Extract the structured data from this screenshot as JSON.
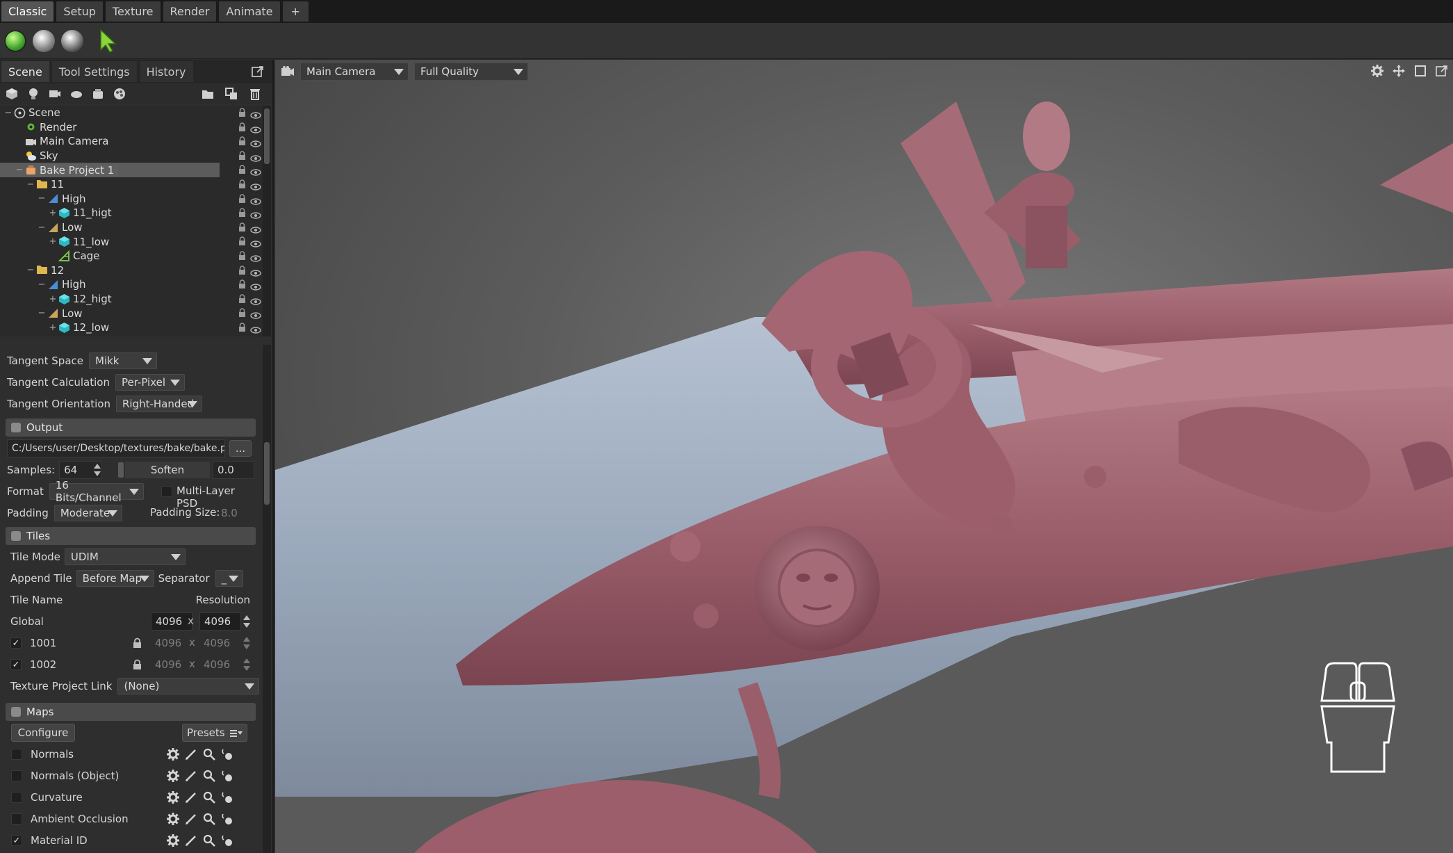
{
  "menu_tabs": [
    "Classic",
    "Setup",
    "Texture",
    "Render",
    "Animate",
    "+"
  ],
  "toolbar": {
    "icons": [
      "render-sphere-green-icon",
      "sphere-grey-icon",
      "sphere-shaded-icon",
      "select-arrow-icon"
    ]
  },
  "panel_tabs": [
    "Scene",
    "Tool Settings",
    "History"
  ],
  "scene_tree": [
    {
      "label": "Scene",
      "depth": 0,
      "icon": "scene-icon",
      "expander": "−"
    },
    {
      "label": "Render",
      "depth": 1,
      "icon": "gear-icon",
      "expander": ""
    },
    {
      "label": "Main Camera",
      "depth": 1,
      "icon": "camera-icon",
      "expander": ""
    },
    {
      "label": "Sky",
      "depth": 1,
      "icon": "sky-icon",
      "expander": ""
    },
    {
      "label": "Bake Project 1",
      "depth": 1,
      "icon": "bake-icon",
      "expander": "−",
      "selected": true
    },
    {
      "label": "11",
      "depth": 2,
      "icon": "folder-icon",
      "expander": "−"
    },
    {
      "label": "High",
      "depth": 3,
      "icon": "high-group-icon",
      "expander": "−"
    },
    {
      "label": "11_higt",
      "depth": 4,
      "icon": "mesh-icon",
      "expander": "+"
    },
    {
      "label": "Low",
      "depth": 3,
      "icon": "low-group-icon",
      "expander": "−"
    },
    {
      "label": "11_low",
      "depth": 4,
      "icon": "mesh-icon",
      "expander": "+"
    },
    {
      "label": "Cage",
      "depth": 4,
      "icon": "cage-icon",
      "expander": ""
    },
    {
      "label": "12",
      "depth": 2,
      "icon": "folder-icon",
      "expander": "−"
    },
    {
      "label": "High",
      "depth": 3,
      "icon": "high-group-icon",
      "expander": "−"
    },
    {
      "label": "12_higt",
      "depth": 4,
      "icon": "mesh-icon",
      "expander": "+"
    },
    {
      "label": "Low",
      "depth": 3,
      "icon": "low-group-icon",
      "expander": "−"
    },
    {
      "label": "12_low",
      "depth": 4,
      "icon": "mesh-icon",
      "expander": "+"
    }
  ],
  "tangent": {
    "space_label": "Tangent Space",
    "space_value": "Mikk",
    "calc_label": "Tangent Calculation",
    "calc_value": "Per-Pixel",
    "orient_label": "Tangent Orientation",
    "orient_value": "Right-Handed"
  },
  "output": {
    "section": "Output",
    "path": "C:/Users/user/Desktop/textures/bake/bake.ps",
    "browse": "...",
    "samples_label": "Samples:",
    "samples_value": "64",
    "soften_label": "Soften",
    "soften_value": "0.0",
    "format_label": "Format",
    "format_value": "16 Bits/Channel",
    "multilayer_label": "Multi-Layer PSD",
    "padding_label": "Padding",
    "padding_value": "Moderate",
    "padding_size_label": "Padding Size:",
    "padding_size_value": "8.0"
  },
  "tiles": {
    "section": "Tiles",
    "mode_label": "Tile Mode",
    "mode_value": "UDIM",
    "append_label": "Append Tile",
    "append_value": "Before Map",
    "separator_label": "Separator",
    "separator_value": "_",
    "col_name": "Tile Name",
    "col_res": "Resolution",
    "global_label": "Global",
    "global_w": "4096",
    "global_h": "4096",
    "x": "x",
    "rows": [
      {
        "name": "1001",
        "w": "4096",
        "h": "4096",
        "checked": true
      },
      {
        "name": "1002",
        "w": "4096",
        "h": "4096",
        "checked": true
      }
    ],
    "link_label": "Texture Project Link",
    "link_value": "(None)"
  },
  "maps": {
    "section": "Maps",
    "configure": "Configure",
    "presets": "Presets",
    "items": [
      {
        "label": "Normals",
        "checked": false
      },
      {
        "label": "Normals (Object)",
        "checked": false
      },
      {
        "label": "Curvature",
        "checked": false
      },
      {
        "label": "Ambient Occlusion",
        "checked": false
      },
      {
        "label": "Material ID",
        "checked": true
      }
    ]
  },
  "viewport": {
    "camera": "Main Camera",
    "quality": "Full Quality",
    "model_colors": {
      "high_poly": "#9c5e6a",
      "low_poly": "#98a6b8",
      "background": "#5e5e5e"
    }
  }
}
